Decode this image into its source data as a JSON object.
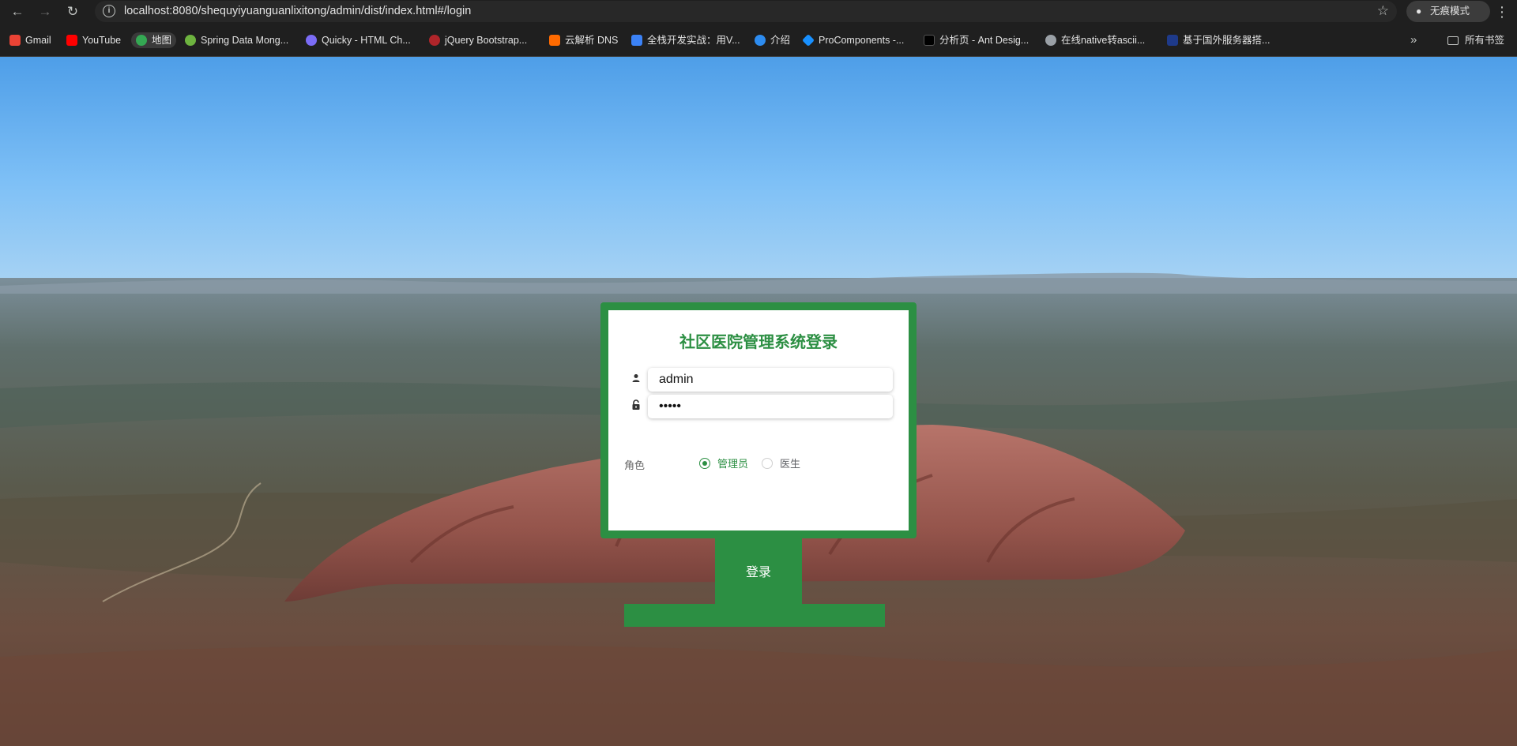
{
  "browser": {
    "url": "localhost:8080/shequyiyuanguanlixitong/admin/dist/index.html#/login",
    "incognito_label": "无痕模式",
    "nav": {
      "back_icon": "arrow-left-icon",
      "forward_icon": "arrow-right-icon",
      "reload_icon": "reload-icon"
    },
    "bookmarks": [
      {
        "label": "Gmail",
        "icon": "gmail-icon",
        "color": "#ea4335"
      },
      {
        "label": "YouTube",
        "icon": "youtube-icon",
        "color": "#ff0000"
      },
      {
        "label": "地图",
        "icon": "maps-icon",
        "color": "#34a853"
      },
      {
        "label": "Spring Data Mong...",
        "icon": "spring-icon",
        "color": "#6db33f"
      },
      {
        "label": "Quicky - HTML Ch...",
        "icon": "quicky-icon",
        "color": "#7b6cf6"
      },
      {
        "label": "jQuery Bootstrap...",
        "icon": "jquery-icon",
        "color": "#b0252a"
      },
      {
        "label": "云解析 DNS",
        "icon": "aliyun-icon",
        "color": "#ff6a00"
      },
      {
        "label": "全栈开发实战：用V...",
        "icon": "m-icon",
        "color": "#3b82f6"
      },
      {
        "label": "介绍",
        "icon": "globe-icon",
        "color": "#2d8cf0"
      },
      {
        "label": "ProComponents -...",
        "icon": "procomponents-icon",
        "color": "#1890ff"
      },
      {
        "label": "分析页 - Ant Desig...",
        "icon": "pro-icon",
        "color": "#000000"
      },
      {
        "label": "在线native转ascii...",
        "icon": "globe-icon",
        "color": "#9aa0a6"
      },
      {
        "label": "基于国外服务器搭...",
        "icon": "flag-icon",
        "color": "#1e3a8a"
      }
    ],
    "all_bookmarks_label": "所有书签"
  },
  "login": {
    "title": "社区医院管理系统登录",
    "username_value": "admin",
    "password_value": "•••••",
    "role_label": "角色",
    "roles": [
      {
        "label": "管理员",
        "checked": true
      },
      {
        "label": "医生",
        "checked": false
      }
    ],
    "submit_label": "登录",
    "accent_color": "#2c8f43"
  }
}
